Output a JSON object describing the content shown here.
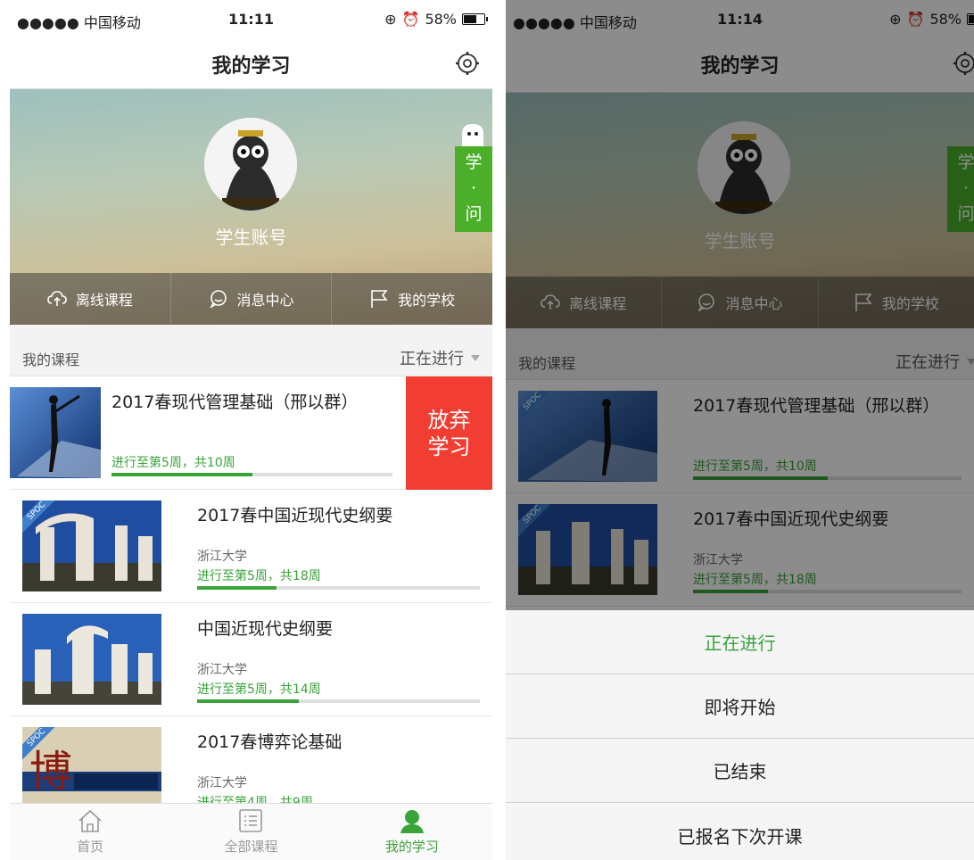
{
  "status": {
    "carrier": "●●●●● 中国移动",
    "battery": "58%",
    "time_left": "11:11",
    "time_right": "11:14",
    "battery_level": 0.58
  },
  "navbar": {
    "title": "我的学习"
  },
  "profile": {
    "username": "学生账号",
    "ask_tab": [
      "学",
      "·",
      "问"
    ]
  },
  "menu": [
    {
      "label": "离线课程",
      "icon": "cloud-upload-icon"
    },
    {
      "label": "消息中心",
      "icon": "chat-icon"
    },
    {
      "label": "我的学校",
      "icon": "flag-icon"
    }
  ],
  "courses_section": {
    "label": "我的课程",
    "filter": "正在进行"
  },
  "courses": [
    {
      "title": "2017春现代管理基础（邢以群）",
      "school": "",
      "progress_text": "进行至第5周，共10周",
      "progress": 0.5
    },
    {
      "title": "2017春中国近现代史纲要",
      "school": "浙江大学",
      "progress_text": "进行至第5周，共18周",
      "progress": 0.28
    },
    {
      "title": "中国近现代史纲要",
      "school": "浙江大学",
      "progress_text": "进行至第5周，共14周",
      "progress": 0.36
    },
    {
      "title": "2017春博弈论基础",
      "school": "浙江大学",
      "progress_text": "进行至第4周，共9周",
      "progress": 0.44
    }
  ],
  "abandon_button": {
    "line1": "放弃",
    "line2": "学习"
  },
  "spoc_badge": "SPOC",
  "tabbar": [
    {
      "label": "首页",
      "icon": "home-icon"
    },
    {
      "label": "全部课程",
      "icon": "list-icon"
    },
    {
      "label": "我的学习",
      "icon": "profile-icon"
    }
  ],
  "filter_sheet": [
    "正在进行",
    "即将开始",
    "已结束",
    "已报名下次开课"
  ],
  "colors": {
    "accent": "#3aa33a",
    "danger": "#f13d32",
    "ask_tab": "#4caf2a"
  }
}
